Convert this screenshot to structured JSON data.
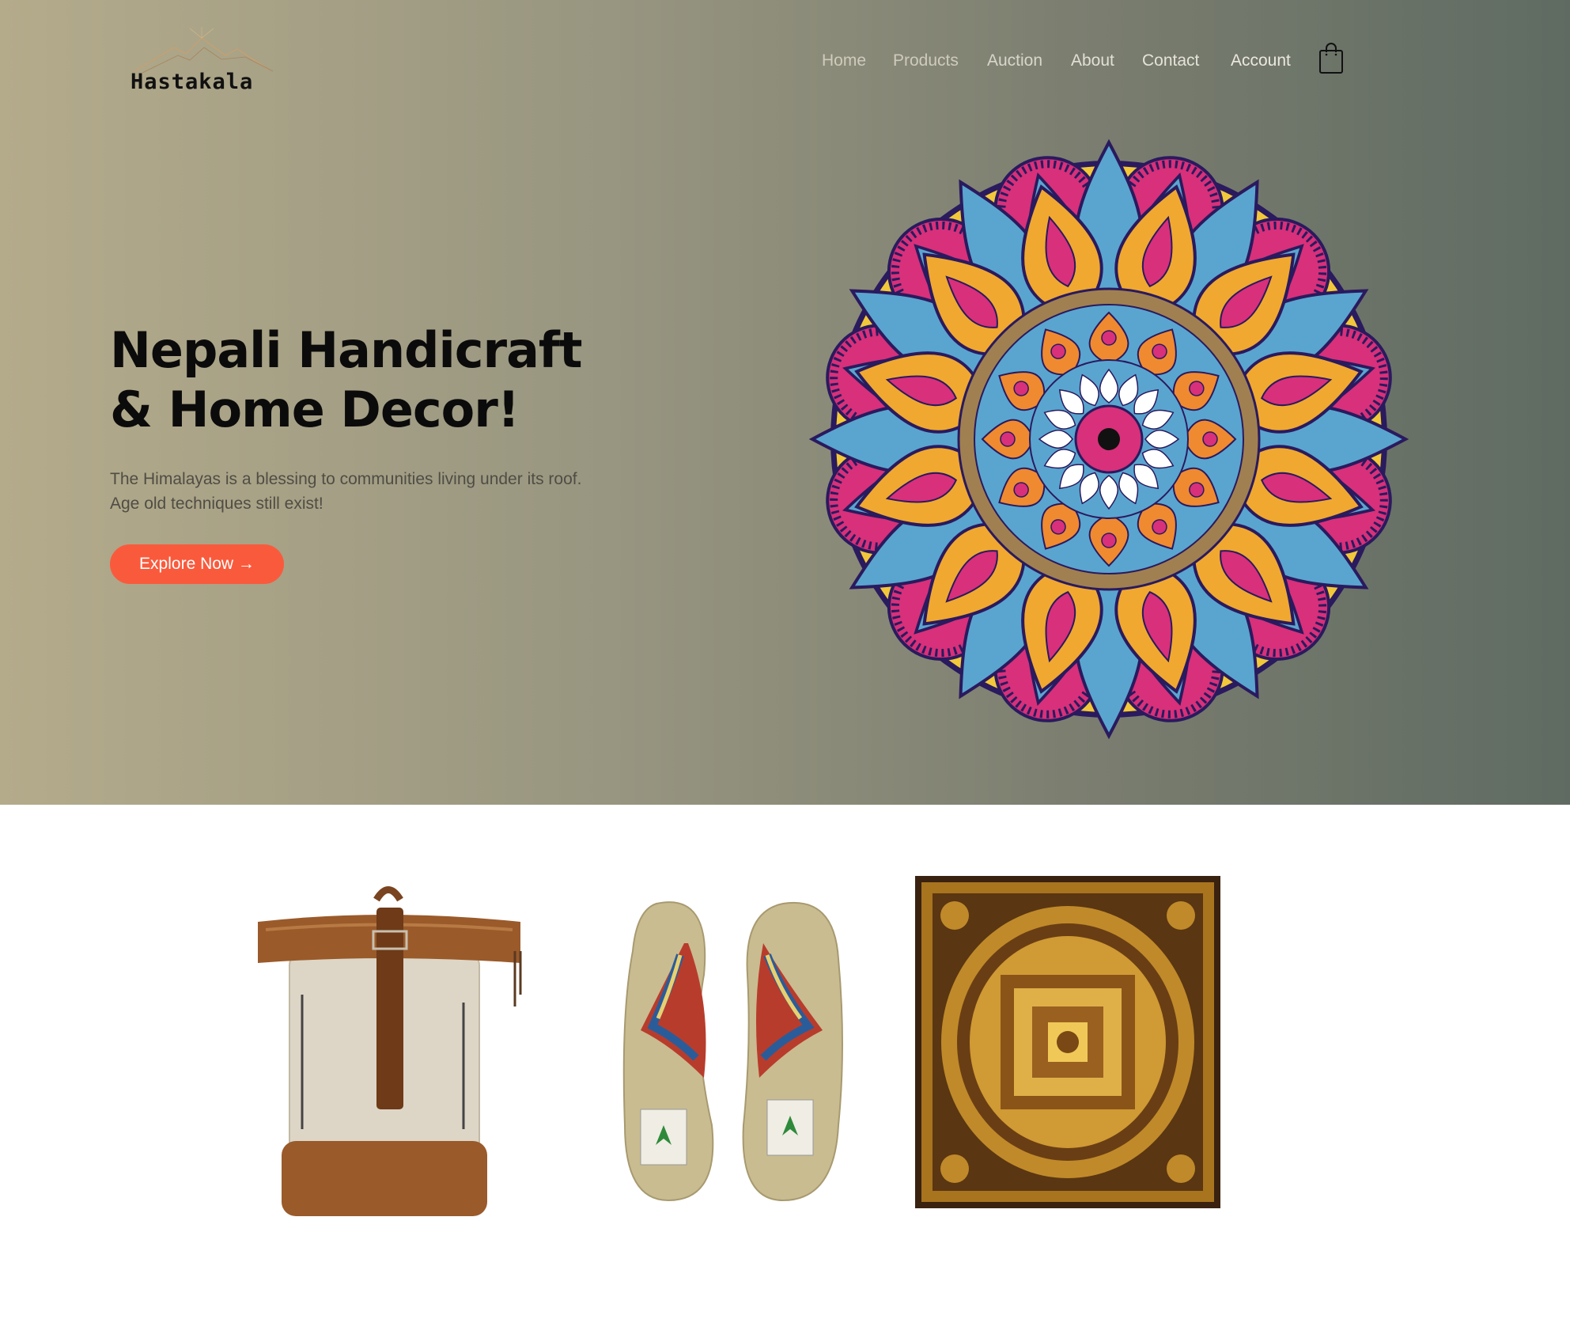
{
  "brand": {
    "name": "Hastakala"
  },
  "nav": {
    "links": [
      "Home",
      "Products",
      "Auction",
      "About",
      "Contact",
      "Account"
    ],
    "cart_icon": "shopping-bag-icon"
  },
  "hero": {
    "title_line1": "Nepali Handicraft",
    "title_line2": "& Home Decor!",
    "subtitle_line1": "The Himalayas is a blessing to communities living under its roof.",
    "subtitle_line2": "Age old techniques still exist!",
    "cta_label": "Explore Now →",
    "artwork": "mandala-illustration"
  },
  "products": [
    {
      "name": "hemp-backpack",
      "image": "backpack-image"
    },
    {
      "name": "hemp-flip-flops",
      "image": "sandals-image"
    },
    {
      "name": "mandala-thangka",
      "image": "thangka-image"
    }
  ],
  "colors": {
    "accent": "#fa5a3c",
    "hero_gradient_start": "#b4ab8b",
    "hero_gradient_end": "#5f6b62",
    "nav_text": "#e0ddd0"
  }
}
